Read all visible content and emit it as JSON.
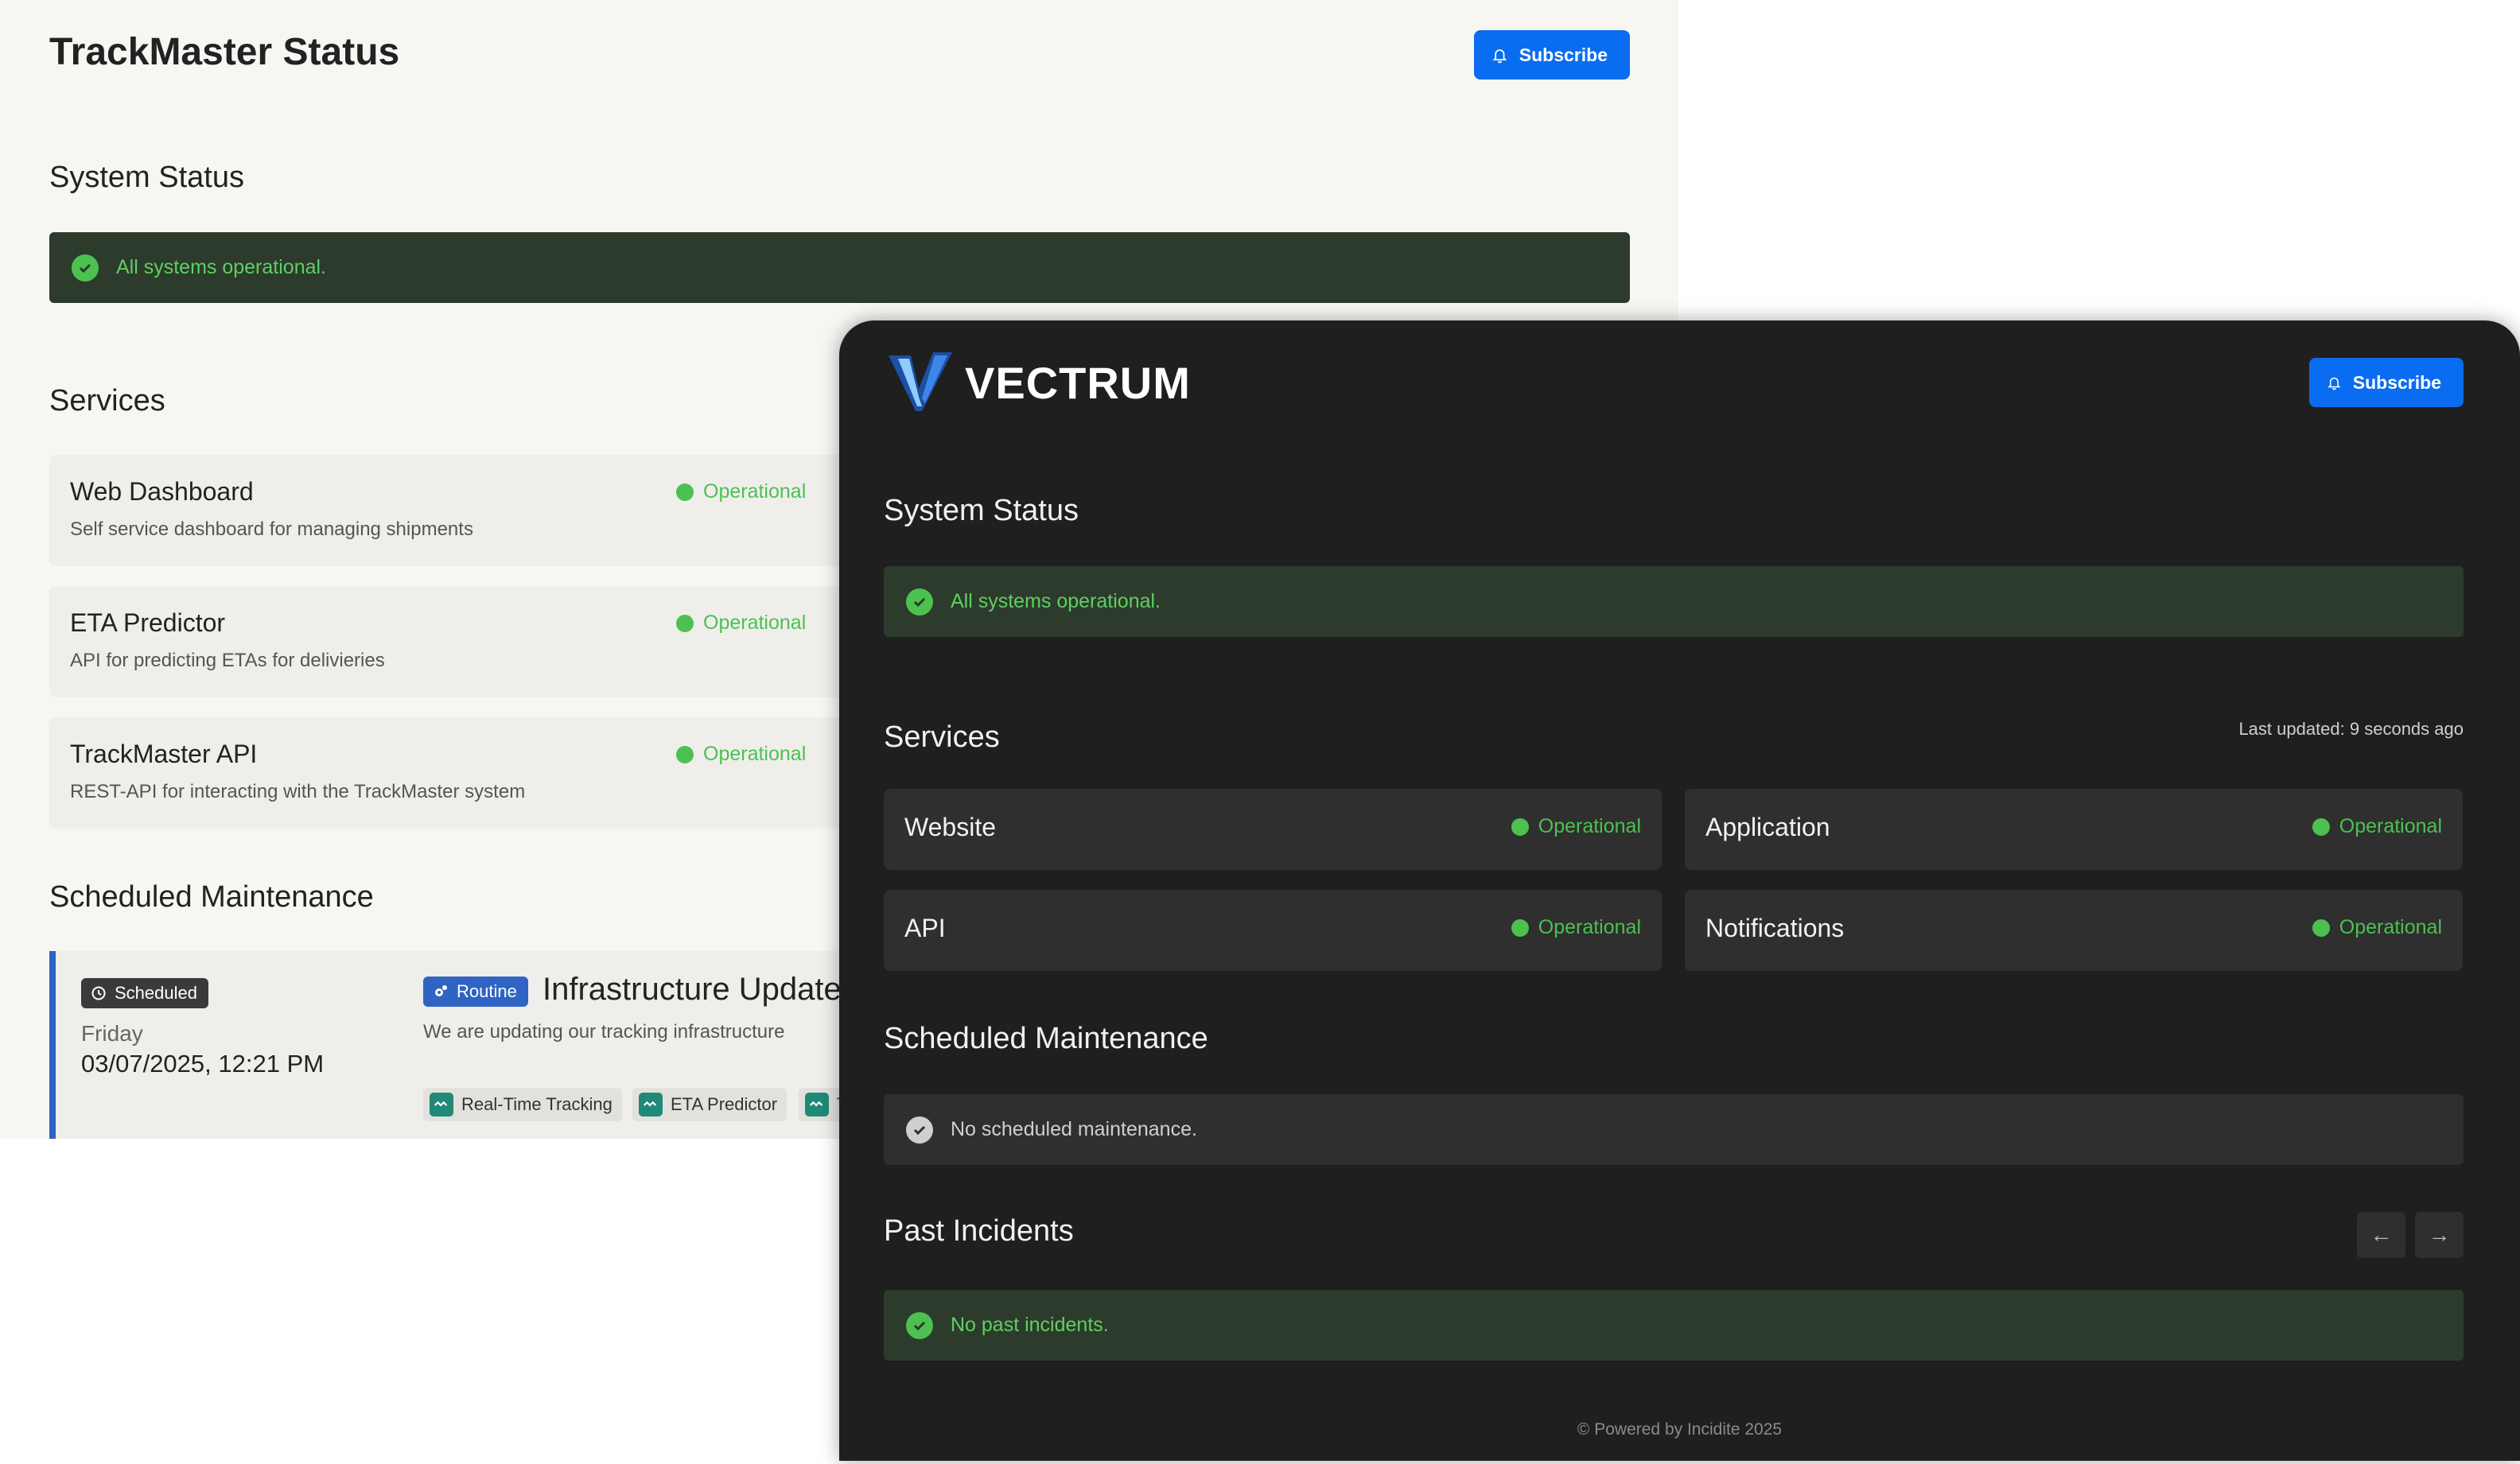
{
  "light": {
    "title": "TrackMaster Status",
    "subscribe_label": "Subscribe",
    "system_status_heading": "System Status",
    "status_banner": "All systems operational.",
    "services_heading": "Services",
    "services": [
      {
        "name": "Web Dashboard",
        "description": "Self service dashboard for managing shipments",
        "status": "Operational"
      },
      {
        "name": "ETA Predictor",
        "description": "API for predicting ETAs for delivieries",
        "status": "Operational"
      },
      {
        "name": "TrackMaster API",
        "description": "REST-API for interacting with the TrackMaster system",
        "status": "Operational"
      }
    ],
    "maintenance_heading": "Scheduled Maintenance",
    "maintenance": {
      "state_badge": "Scheduled",
      "type_badge": "Routine",
      "day": "Friday",
      "date": "03/07/2025, 12:21 PM",
      "title": "Infrastructure Updates",
      "description": "We are updating our tracking infrastructure",
      "affected": [
        "Real-Time Tracking",
        "ETA Predictor",
        "T"
      ]
    }
  },
  "dark": {
    "brand": "VECTRUM",
    "subscribe_label": "Subscribe",
    "system_status_heading": "System Status",
    "status_banner": "All systems operational.",
    "services_heading": "Services",
    "last_updated": "Last updated: 9 seconds ago",
    "services": [
      {
        "name": "Website",
        "status": "Operational"
      },
      {
        "name": "Application",
        "status": "Operational"
      },
      {
        "name": "API",
        "status": "Operational"
      },
      {
        "name": "Notifications",
        "status": "Operational"
      }
    ],
    "maintenance_heading": "Scheduled Maintenance",
    "no_maintenance": "No scheduled maintenance.",
    "incidents_heading": "Past Incidents",
    "prev_label": "←",
    "next_label": "→",
    "no_incidents": "No past incidents.",
    "footer": "© Powered by Incidite 2025"
  },
  "colors": {
    "accent_blue": "#0a6cf0",
    "operational_green": "#4cc150",
    "banner_green_bg": "#2c3b2b",
    "dark_bg": "#1f1f1f",
    "light_bg": "#f7f6f3"
  }
}
